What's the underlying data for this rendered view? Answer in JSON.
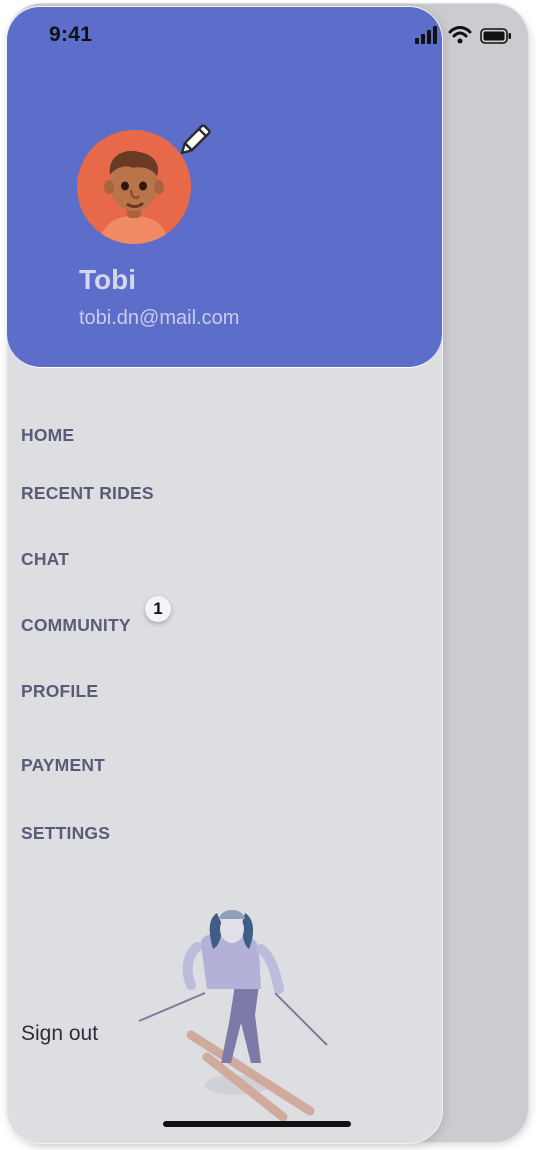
{
  "status_bar": {
    "time": "9:41"
  },
  "profile": {
    "name": "Tobi",
    "email": "tobi.dn@mail.com",
    "edit_icon": "pencil-icon"
  },
  "menu": {
    "items": [
      {
        "label": "HOME"
      },
      {
        "label": "RECENT RIDES"
      },
      {
        "label": "CHAT"
      },
      {
        "label": "COMMUNITY",
        "badge": "1"
      },
      {
        "label": "PROFILE"
      },
      {
        "label": "PAYMENT"
      },
      {
        "label": "SETTINGS"
      }
    ]
  },
  "footer": {
    "sign_out_label": "Sign out"
  },
  "colors": {
    "header": "#5c6dca",
    "drawer_bg": "#dddee1",
    "menu_text": "#5b5a78",
    "avatar_bg": "#e8694a"
  }
}
